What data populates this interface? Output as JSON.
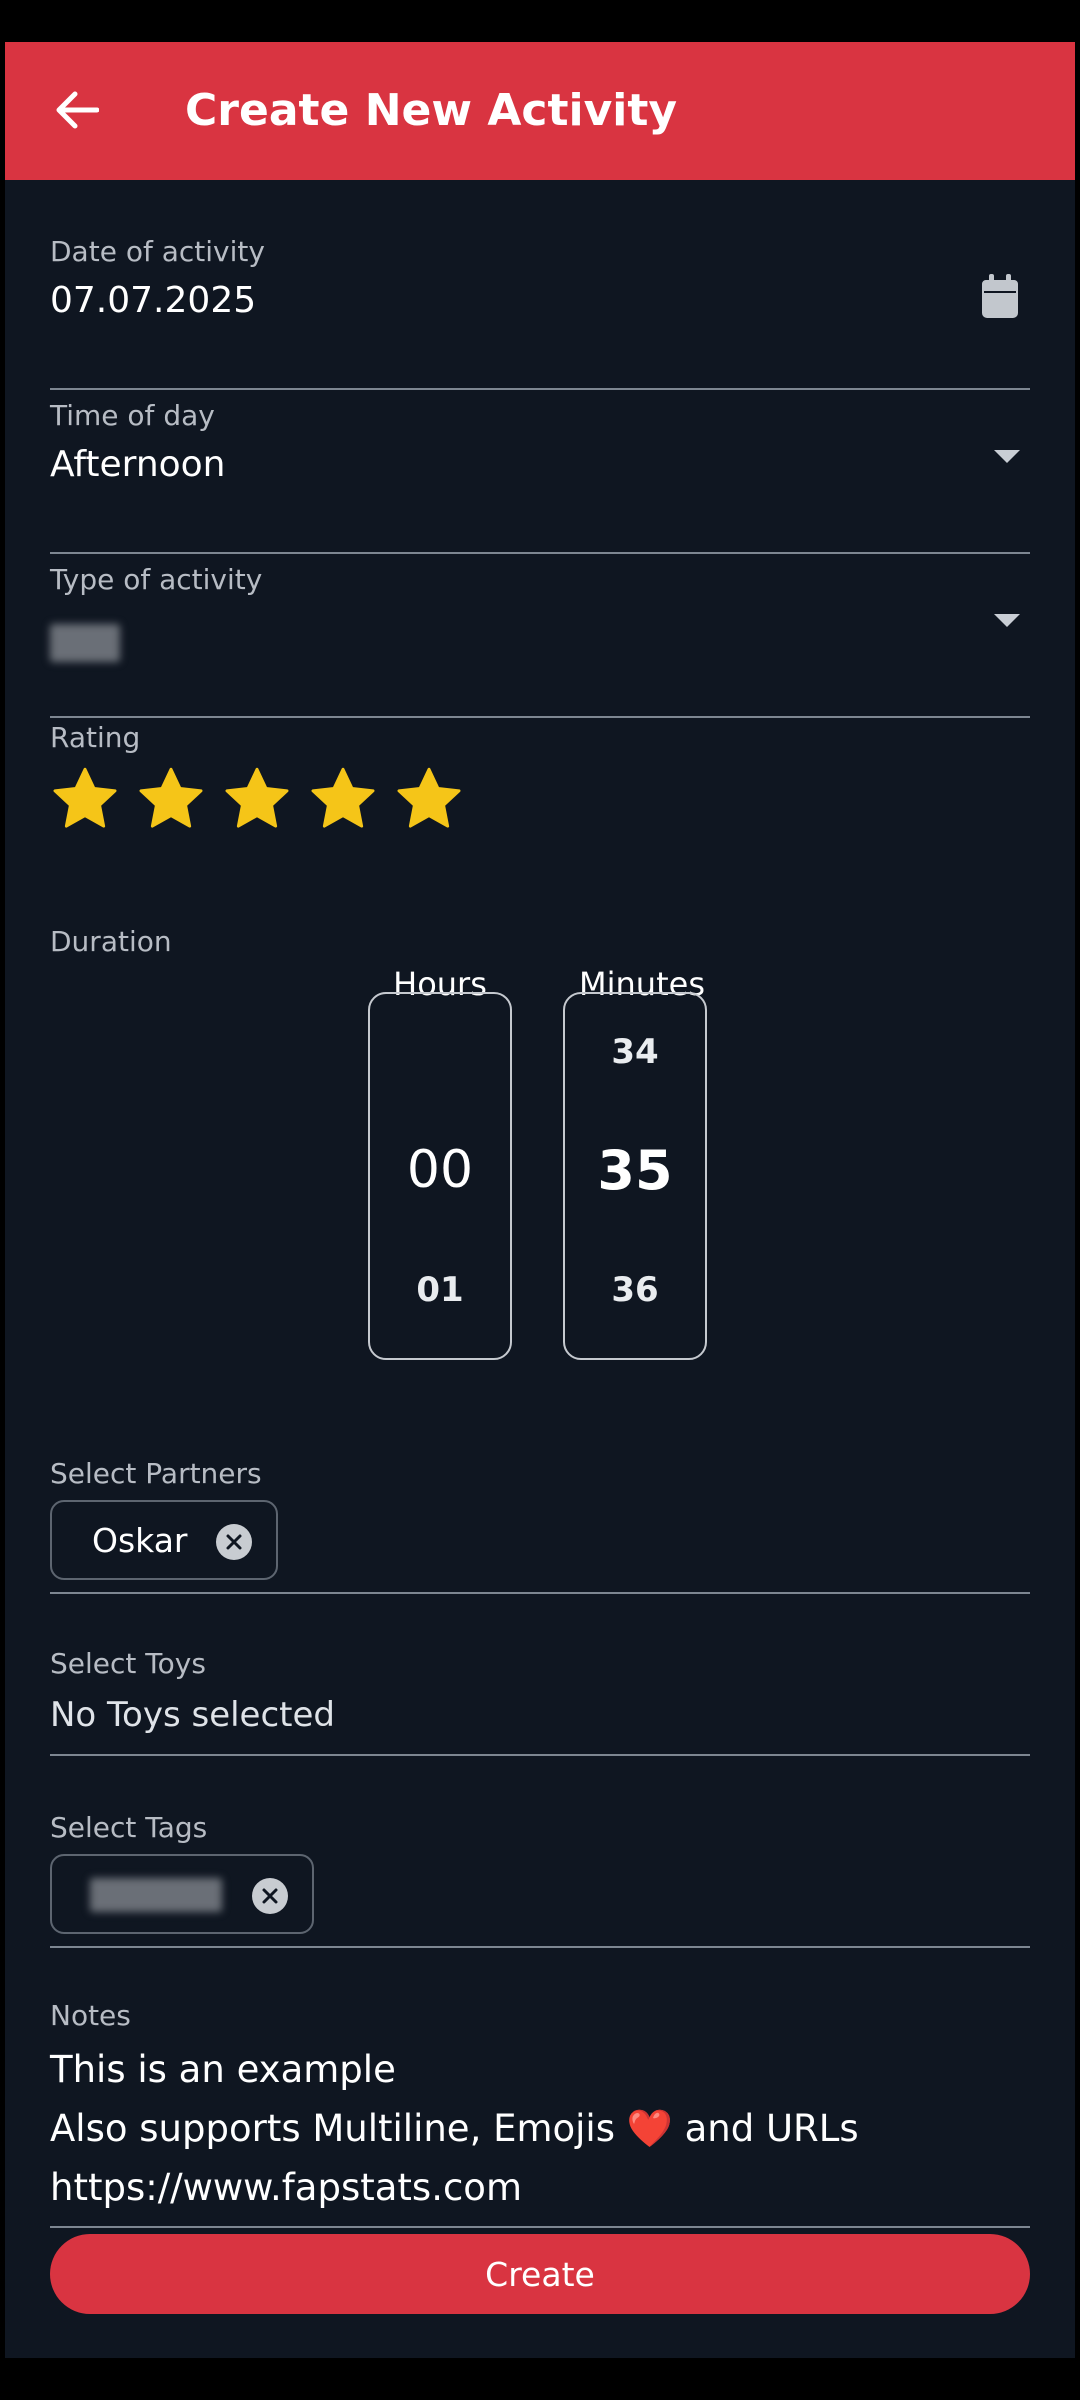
{
  "app_bar": {
    "title": "Create New Activity",
    "back_icon": "arrow-left-icon",
    "color": "#d93441"
  },
  "date": {
    "label": "Date of activity",
    "value": "07.07.2025",
    "icon": "calendar-icon"
  },
  "time_of_day": {
    "label": "Time of day",
    "value": "Afternoon"
  },
  "activity_type": {
    "label": "Type of activity",
    "value_redacted": true
  },
  "rating": {
    "label": "Rating",
    "value": 5,
    "max": 5,
    "star_color": "#f5c518"
  },
  "duration": {
    "label": "Duration",
    "hours": {
      "header": "Hours",
      "prev": "",
      "current": "00",
      "next": "01"
    },
    "minutes": {
      "header": "Minutes",
      "prev": "34",
      "current": "35",
      "next": "36"
    }
  },
  "partners": {
    "label": "Select Partners",
    "chips": [
      "Oskar"
    ]
  },
  "toys": {
    "label": "Select Toys",
    "value": "No Toys selected"
  },
  "tags": {
    "label": "Select Tags",
    "chip_redacted": true
  },
  "notes": {
    "label": "Notes",
    "line1": "This is an example",
    "line2_prefix": "Also supports Multiline, Emojis",
    "line2_emoji": "❤️",
    "line2_suffix": "and URLs",
    "line3": "https://www.fapstats.com"
  },
  "create_button": {
    "label": "Create"
  }
}
